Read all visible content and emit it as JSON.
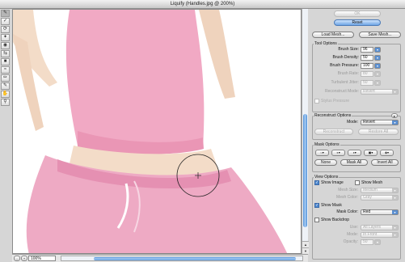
{
  "window": {
    "title": "Liquify (Handles.jpg @ 200%)"
  },
  "toolbar": {
    "tools": [
      "forward-warp-tool",
      "reconstruct-tool",
      "twirl-tool",
      "pucker-tool",
      "bloat-tool",
      "push-left-tool",
      "mirror-tool",
      "turbulence-tool",
      "freeze-mask-tool",
      "thaw-mask-tool",
      "hand-tool",
      "zoom-tool"
    ]
  },
  "status": {
    "zoom": "100%"
  },
  "panel": {
    "ok_label": "OK",
    "reset_label": "Reset",
    "load_mesh_label": "Load Mesh...",
    "save_mesh_label": "Save Mesh...",
    "tool_options": {
      "title": "Tool Options",
      "brush_size_label": "Brush Size:",
      "brush_size": "96",
      "brush_density_label": "Brush Density:",
      "brush_density": "50",
      "brush_pressure_label": "Brush Pressure:",
      "brush_pressure": "100",
      "brush_rate_label": "Brush Rate:",
      "brush_rate": "80",
      "turbulent_jitter_label": "Turbulent Jitter:",
      "turbulent_jitter": "50",
      "reconstruct_mode_label": "Reconstruct Mode:",
      "reconstruct_mode": "Revert",
      "stylus_pressure_label": "Stylus Pressure"
    },
    "reconstruct_options": {
      "title": "Reconstruct Options",
      "mode_label": "Mode:",
      "mode": "Revert",
      "reconstruct_label": "Reconstruct",
      "restore_all_label": "Restore All"
    },
    "mask_options": {
      "title": "Mask Options",
      "none_label": "None",
      "mask_all_label": "Mask All",
      "invert_all_label": "Invert All"
    },
    "view_options": {
      "title": "View Options",
      "show_image_label": "Show Image",
      "show_mesh_label": "Show Mesh",
      "mesh_size_label": "Mesh Size:",
      "mesh_size": "Medium",
      "mesh_color_label": "Mesh Color:",
      "mesh_color": "Gray",
      "show_mask_label": "Show Mask",
      "mask_color_label": "Mask Color:",
      "mask_color": "Red",
      "show_backdrop_label": "Show Backdrop",
      "use_label": "Use:",
      "use_value": "All Layers",
      "mode_label": "Mode:",
      "mode_value": "In Front",
      "opacity_label": "Opacity:",
      "opacity_value": "50"
    }
  },
  "colors": {
    "accent": "#4e88cf",
    "shirt": "#f1a9c4",
    "pants": "#eeaac4",
    "skin": "#f3dcc8"
  }
}
